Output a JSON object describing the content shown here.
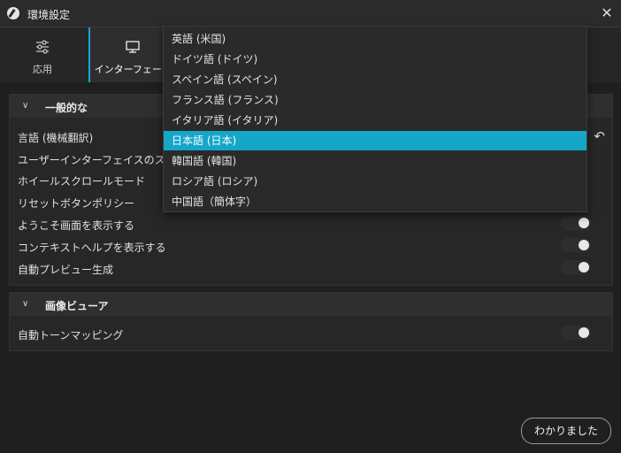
{
  "window": {
    "title": "環境設定",
    "close_icon": "close-icon",
    "app_icon": "app-logo-icon"
  },
  "tabs": [
    {
      "label": "応用",
      "icon": "sliders-icon"
    },
    {
      "label": "インターフェース",
      "icon": "monitor-icon",
      "active": true
    }
  ],
  "general": {
    "title": "一般的な",
    "rows": [
      {
        "label": "言語 (機械翻訳)"
      },
      {
        "label": "ユーザーインターフェイスのスケール"
      },
      {
        "label": "ホイールスクロールモード"
      },
      {
        "label": "リセットボタンポリシー"
      },
      {
        "label": "ようこそ画面を表示する",
        "toggle": true
      },
      {
        "label": "コンテキストヘルプを表示する",
        "toggle": true
      },
      {
        "label": "自動プレビュー生成",
        "toggle": true
      }
    ]
  },
  "viewer": {
    "title": "画像ビューア",
    "rows": [
      {
        "label": "自動トーンマッピング",
        "toggle": true
      }
    ]
  },
  "language_dropdown": {
    "options": [
      "英語 (米国)",
      "ドイツ語 (ドイツ)",
      "スペイン語 (スペイン)",
      "フランス語 (フランス)",
      "イタリア語 (イタリア)",
      "日本語 (日本)",
      "韓国語 (韓国)",
      "ロシア語 (ロシア)",
      "中国語（簡体字）"
    ],
    "selected": "日本語 (日本)"
  },
  "ok_button": "わかりました",
  "colors": {
    "accent": "#15a6c8",
    "background": "#1f1f1f"
  }
}
